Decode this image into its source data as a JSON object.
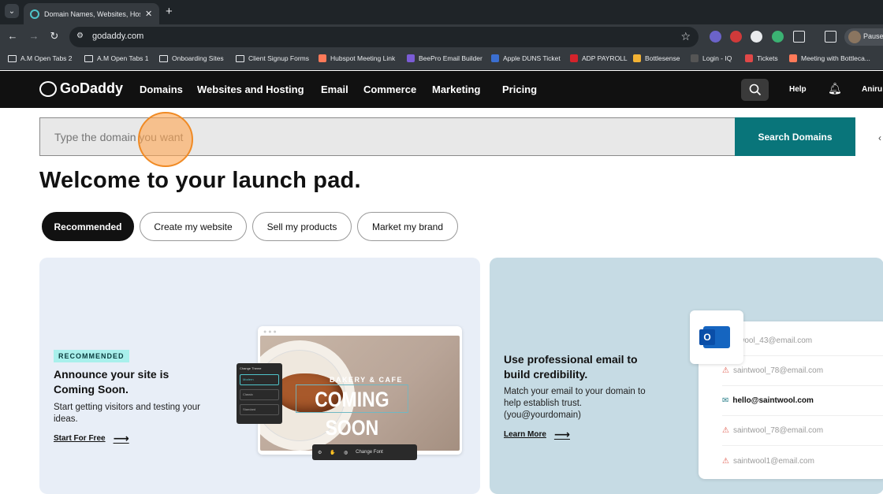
{
  "browser": {
    "tab_title": "Domain Names, Websites, Hosting",
    "url": "godaddy.com",
    "profile_label": "Pause",
    "bookmarks": [
      "A.M Open Tabs 2",
      "A.M Open Tabs 1",
      "Onboarding Sites",
      "Client Signup Forms",
      "Hubspot Meeting Link",
      "BeePro Email Builder",
      "Apple DUNS Ticket",
      "ADP PAYROLL",
      "Bottlesense",
      "Login - IQ",
      "Tickets",
      "Meeting with Bottleca..."
    ]
  },
  "header": {
    "logo": "GoDaddy",
    "nav": [
      "Domains",
      "Websites and Hosting",
      "Email",
      "Commerce",
      "Marketing",
      "Pricing"
    ],
    "help": "Help",
    "user": "Aniru"
  },
  "search": {
    "placeholder": "Type the domain you want",
    "button": "Search Domains"
  },
  "welcome": "Welcome to your launch pad.",
  "pills": [
    "Recommended",
    "Create my website",
    "Sell my products",
    "Market my brand"
  ],
  "card1": {
    "badge": "RECOMMENDED",
    "title": "Announce your site is Coming Soon.",
    "desc": "Start getting visitors and testing your ideas.",
    "link": "Start For Free",
    "illustration": {
      "subtitle": "BAKERY & CAFE",
      "headline": "COMING SOON",
      "panel_title": "Change Theme",
      "themes": [
        "Modern",
        "Classic",
        "Standard"
      ],
      "toolbar_label": "Change Font"
    }
  },
  "card2": {
    "title": "Use professional email to build credibility.",
    "desc": "Match your email to your domain to help establish trust. (you@yourdomain)",
    "link": "Learn More",
    "emails": [
      "saintwool_43@email.com",
      "saintwool_78@email.com",
      "hello@saintwool.com",
      "saintwool_78@email.com",
      "saintwool1@email.com"
    ]
  },
  "colors": {
    "accent": "#09757a",
    "header_bg": "#111111",
    "card1_bg": "#e8eef7",
    "card2_bg": "#c6dbe4",
    "badge": "#a9f0ec"
  }
}
